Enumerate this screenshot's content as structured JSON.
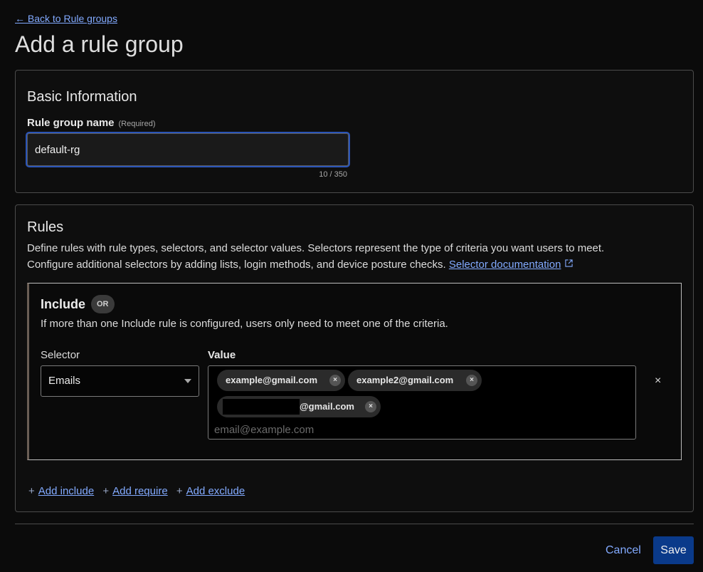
{
  "nav": {
    "back_link": "← Back to Rule groups"
  },
  "page": {
    "title": "Add a rule group"
  },
  "basic": {
    "title": "Basic Information",
    "name_label": "Rule group name",
    "required": "(Required)",
    "name_value": "default-rg",
    "char_count": "10 / 350"
  },
  "rules": {
    "title": "Rules",
    "desc_line1": "Define rules with rule types, selectors, and selector values. Selectors represent the type of criteria you want users to meet.",
    "desc_line2": "Configure additional selectors by adding lists, login methods, and device posture checks.",
    "doc_link": "Selector documentation",
    "include": {
      "title": "Include",
      "badge": "OR",
      "desc": "If more than one Include rule is configured, users only need to meet one of the criteria.",
      "selector_label": "Selector",
      "value_label": "Value",
      "selector_value": "Emails",
      "chips": [
        "example@gmail.com",
        "example2@gmail.com",
        "@gmail.com"
      ],
      "chip_remove": "×",
      "value_placeholder": "email@example.com",
      "remove_rule": "×"
    },
    "add_include": "Add include",
    "add_require": "Add require",
    "add_exclude": "Add exclude",
    "plus": "+"
  },
  "footer": {
    "cancel": "Cancel",
    "save": "Save"
  },
  "colors": {
    "accent": "#82aaff",
    "primary_button": "#0a3a8a",
    "focus_ring": "#2b55b8"
  }
}
